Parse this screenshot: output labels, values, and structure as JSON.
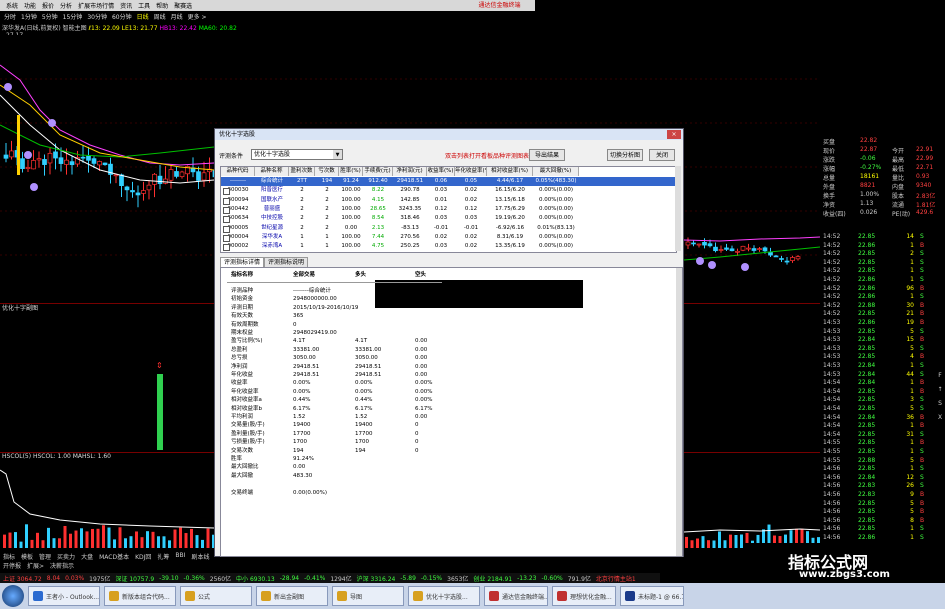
{
  "menubar": {
    "items": [
      "系统",
      "功能",
      "报价",
      "分析",
      "扩展市场行情",
      "资讯",
      "工具",
      "帮助",
      "聚赛选"
    ],
    "right_label": "通达信金融终端"
  },
  "periods": [
    "分时",
    "1分钟",
    "5分钟",
    "15分钟",
    "30分钟",
    "60分钟",
    "日线",
    "周线",
    "月线",
    "更多 >"
  ],
  "stock_info": {
    "name": "深华发A(日线,前复权) 智能主图",
    "ma_text": "ℓ13: 22.09  LE13: 21.77",
    "hb": "HB13: 22.42",
    "mavol": "MA60: 20.82"
  },
  "top_price": "27.17",
  "sub1_title": "优化十字副图",
  "sub2_title": "HSCOL(5)  HSCOL: 1.00  MAHSL: 1.60",
  "bottom_tabs": [
    "指标",
    "模板",
    "管理",
    "买卖力",
    "大盘",
    "MACD基本",
    "KDJ回",
    "扎筹",
    "BBI",
    "剧本线"
  ],
  "bottom_tabs2": [
    "开停报",
    "扩展>",
    "决薪指示"
  ],
  "index_bar": [
    {
      "text": "上证 3064.72",
      "color": "#ff4040"
    },
    {
      "text": "8.04",
      "color": "#ff4040"
    },
    {
      "text": "0.03%",
      "color": "#ff4040"
    },
    {
      "text": "1975亿",
      "color": "#ccc"
    },
    {
      "text": "深证 10757.9",
      "color": "#40ff40"
    },
    {
      "text": "-39.10",
      "color": "#40ff40"
    },
    {
      "text": "-0.36%",
      "color": "#40ff40"
    },
    {
      "text": "2560亿",
      "color": "#ccc"
    },
    {
      "text": "中小 6930.13",
      "color": "#40ff40"
    },
    {
      "text": "-28.94",
      "color": "#40ff40"
    },
    {
      "text": "-0.41%",
      "color": "#40ff40"
    },
    {
      "text": "1294亿",
      "color": "#ccc"
    },
    {
      "text": "沪深 3316.24",
      "color": "#40ff40"
    },
    {
      "text": "-5.89",
      "color": "#40ff40"
    },
    {
      "text": "-0.15%",
      "color": "#40ff40"
    },
    {
      "text": "3653亿",
      "color": "#ccc"
    },
    {
      "text": "创业 2184.91",
      "color": "#40ff40"
    },
    {
      "text": "-13.23",
      "color": "#40ff40"
    },
    {
      "text": "-0.60%",
      "color": "#40ff40"
    },
    {
      "text": "791.9亿",
      "color": "#ccc"
    },
    {
      "text": "北京行情主站1",
      "color": "#ff4040"
    }
  ],
  "taskbar": [
    {
      "label": "王者小 - Outlook...",
      "color": "#2a6ad0"
    },
    {
      "label": "新版本组合代码...",
      "color": "#d7a020"
    },
    {
      "label": "公式",
      "color": "#d7a020"
    },
    {
      "label": "新出金副图",
      "color": "#d7a020"
    },
    {
      "label": "导图",
      "color": "#d7a020"
    },
    {
      "label": "优化十字选股...",
      "color": "#d7a020"
    },
    {
      "label": "通达信金融终端...",
      "color": "#c03030"
    },
    {
      "label": "理想优化金融...",
      "color": "#c03030"
    },
    {
      "label": "未标题-1 @ 66.7...",
      "color": "#1a3a8a"
    }
  ],
  "dialog": {
    "title": "优化十字选股",
    "close": "×",
    "cond_label": "评测条件",
    "cond_value": "优化十字选股",
    "note": "双击列表打开看板品种评测图表",
    "btn_export": "导出结果",
    "btn_switch": "切换分析图",
    "btn_close": "关闭",
    "columns": [
      "品种代码",
      "品种名称",
      "盈利次数",
      "亏次数",
      "胜率(%)",
      "手续费(元)",
      "净利润(元)",
      "收益率(%)",
      "年化收益率(%)",
      "相对收益率(%)",
      "最大回撤(%)"
    ],
    "rows": [
      [
        "--------",
        "综合统计",
        "2TT",
        "194",
        "91.24",
        "912.40",
        "29418.51",
        "0.06",
        "0.05",
        "4.44/6.17",
        "0.05%(483.30)"
      ],
      [
        "300030",
        "阳普医疗",
        "2",
        "2",
        "100.00",
        "8.22",
        "290.78",
        "0.03",
        "0.02",
        "16.15/6.20",
        "0.00%(0.00)"
      ],
      [
        "300094",
        "国联水产",
        "2",
        "2",
        "100.00",
        "4.15",
        "142.85",
        "0.01",
        "0.02",
        "13.15/6.18",
        "0.00%(0.00)"
      ],
      [
        "300442",
        "普丽盛",
        "2",
        "2",
        "100.00",
        "28.65",
        "3243.35",
        "0.12",
        "0.12",
        "17.75/6.29",
        "0.00%(0.00)"
      ],
      [
        "600634",
        "中技控股",
        "2",
        "2",
        "100.00",
        "8.54",
        "318.46",
        "0.03",
        "0.03",
        "19.19/6.20",
        "0.00%(0.00)"
      ],
      [
        "000005",
        "世纪星源",
        "2",
        "2",
        "0.00",
        "2.13",
        "-83.13",
        "-0.01",
        "-0.01",
        "-6.92/6.16",
        "0.01%(83.13)"
      ],
      [
        "000004",
        "深华发A",
        "1",
        "1",
        "100.00",
        "7.44",
        "270.56",
        "0.02",
        "0.02",
        "8.31/6.19",
        "0.00%(0.00)"
      ],
      [
        "000002",
        "深赤湾A",
        "1",
        "1",
        "100.00",
        "4.75",
        "250.25",
        "0.03",
        "0.02",
        "13.35/6.19",
        "0.00%(0.00)"
      ]
    ],
    "tabs": [
      "评测指标详情",
      "评测指标说明"
    ],
    "report_header": [
      "指标名称",
      "全部交易",
      "多头",
      "空头"
    ],
    "report": [
      [
        "评测品种",
        "--------综合统计",
        "",
        ""
      ],
      [
        "初始资金",
        "2948000000.00",
        "",
        ""
      ],
      [
        "评测日期",
        "2015/10/19-2016/10/19",
        "",
        ""
      ],
      [
        "有效天数",
        "365",
        "",
        ""
      ],
      [
        "有效周期数",
        "0",
        "",
        ""
      ],
      [
        "期末权益",
        "2948029419.00",
        "",
        ""
      ],
      [
        "盈亏比例(%)",
        "4.1T",
        "4.1T",
        "0.00"
      ],
      [
        "总盈利",
        "33381.00",
        "33381.00",
        "0.00"
      ],
      [
        "总亏损",
        "3050.00",
        "3050.00",
        "0.00"
      ],
      [
        "净利润",
        "29418.51",
        "29418.51",
        "0.00"
      ],
      [
        "年化收益",
        "29418.51",
        "29418.51",
        "0.00"
      ],
      [
        "收益率",
        "0.00%",
        "0.00%",
        "0.00%"
      ],
      [
        "年化收益率",
        "0.00%",
        "0.00%",
        "0.00%"
      ],
      [
        "相对收益率a",
        "0.44%",
        "0.44%",
        "0.00%"
      ],
      [
        "相对收益率b",
        "6.17%",
        "6.17%",
        "6.17%"
      ],
      [
        "平均利润",
        "1.52",
        "1.52",
        "0.00"
      ],
      [
        "交易量(股/手)",
        "19400",
        "19400",
        "0"
      ],
      [
        "盈利量(股/手)",
        "17700",
        "17700",
        "0"
      ],
      [
        "亏损量(股/手)",
        "1700",
        "1700",
        "0"
      ],
      [
        "交易次数",
        "194",
        "194",
        "0"
      ],
      [
        "胜率",
        "91.24%",
        "",
        ""
      ],
      [
        "最大回撤比",
        "0.00",
        "",
        ""
      ],
      [
        "最大回撤",
        "483.30",
        "",
        ""
      ],
      [
        "",
        "",
        "",
        ""
      ],
      [
        "交易终端",
        "0.00(0.00%)",
        "",
        ""
      ]
    ]
  },
  "right_panel": {
    "header": [
      {
        "label": "买盘",
        "val": "22.82",
        "c": "#ff4040",
        "n": ""
      },
      {
        "label": "现价",
        "val": "22.87",
        "c": "#ff4040",
        "n2l": "今开",
        "n2": "22.91"
      },
      {
        "label": "涨跌",
        "val": "-0.06",
        "c": "#40ff40",
        "n2l": "最高",
        "n2": "22.99"
      },
      {
        "label": "涨幅",
        "val": "-0.27%",
        "c": "#40ff40",
        "n2l": "最低",
        "n2": "22.71"
      },
      {
        "label": "总量",
        "val": "18161",
        "c": "#ff0",
        "n2l": "量比",
        "n2": "0.93"
      },
      {
        "label": "外盘",
        "val": "8821",
        "c": "#ff4040",
        "n2l": "内盘",
        "n2": "9340"
      },
      {
        "label": "换手",
        "val": "1.00%",
        "c": "#ccc",
        "n2l": "股本",
        "n2": "2.83亿"
      },
      {
        "label": "净资",
        "val": "1.13",
        "c": "#ccc",
        "n2l": "流通",
        "n2": "1.81亿"
      },
      {
        "label": "收益(四)",
        "val": "0.026",
        "c": "#ccc",
        "n2l": "PE(动)",
        "n2": "429.6"
      }
    ],
    "ticks": [
      [
        "14:52",
        "22.85",
        "14",
        "S"
      ],
      [
        "14:52",
        "22.86",
        "1",
        "B"
      ],
      [
        "14:52",
        "22.85",
        "2",
        "S"
      ],
      [
        "14:52",
        "22.85",
        "1",
        "S"
      ],
      [
        "14:52",
        "22.85",
        "1",
        "S"
      ],
      [
        "14:52",
        "22.86",
        "1",
        "S"
      ],
      [
        "14:52",
        "22.86",
        "96",
        "B"
      ],
      [
        "14:52",
        "22.86",
        "1",
        "S"
      ],
      [
        "14:52",
        "22.88",
        "30",
        "B"
      ],
      [
        "14:52",
        "22.85",
        "21",
        "B"
      ],
      [
        "14:53",
        "22.86",
        "19",
        "B"
      ],
      [
        "14:53",
        "22.85",
        "5",
        "S"
      ],
      [
        "14:53",
        "22.84",
        "15",
        "B"
      ],
      [
        "14:53",
        "22.85",
        "5",
        "S"
      ],
      [
        "14:53",
        "22.85",
        "4",
        "B"
      ],
      [
        "14:53",
        "22.84",
        "1",
        "S"
      ],
      [
        "14:53",
        "22.84",
        "44",
        "S"
      ],
      [
        "14:54",
        "22.84",
        "1",
        "B"
      ],
      [
        "14:54",
        "22.85",
        "1",
        "B"
      ],
      [
        "14:54",
        "22.85",
        "3",
        "S"
      ],
      [
        "14:54",
        "22.85",
        "5",
        "S"
      ],
      [
        "14:54",
        "22.84",
        "36",
        "B"
      ],
      [
        "14:54",
        "22.85",
        "1",
        "B"
      ],
      [
        "14:54",
        "22.85",
        "31",
        "S"
      ],
      [
        "14:55",
        "22.85",
        "1",
        "B"
      ],
      [
        "14:55",
        "22.85",
        "1",
        "S"
      ],
      [
        "14:55",
        "22.88",
        "5",
        "B"
      ],
      [
        "14:56",
        "22.85",
        "1",
        "S"
      ],
      [
        "14:56",
        "22.84",
        "12",
        "S"
      ],
      [
        "14:56",
        "22.83",
        "26",
        "S"
      ],
      [
        "14:56",
        "22.83",
        "9",
        "B"
      ],
      [
        "14:56",
        "22.85",
        "5",
        "B"
      ],
      [
        "14:56",
        "22.85",
        "5",
        "B"
      ],
      [
        "14:56",
        "22.85",
        "8",
        "B"
      ],
      [
        "14:56",
        "22.85",
        "1",
        "S"
      ],
      [
        "14:56",
        "22.86",
        "1",
        "S"
      ],
      [
        "14:56",
        "22.86",
        "2",
        "B"
      ],
      [
        "14:57",
        "22.87",
        "100",
        "S"
      ],
      [
        "14:57",
        "22.86",
        "8",
        "B"
      ]
    ]
  },
  "edge_labels": [
    "F",
    "↑",
    "S",
    "X"
  ],
  "watermark": {
    "line1": "指标公式网",
    "line2": "www.zbgs3.com"
  }
}
